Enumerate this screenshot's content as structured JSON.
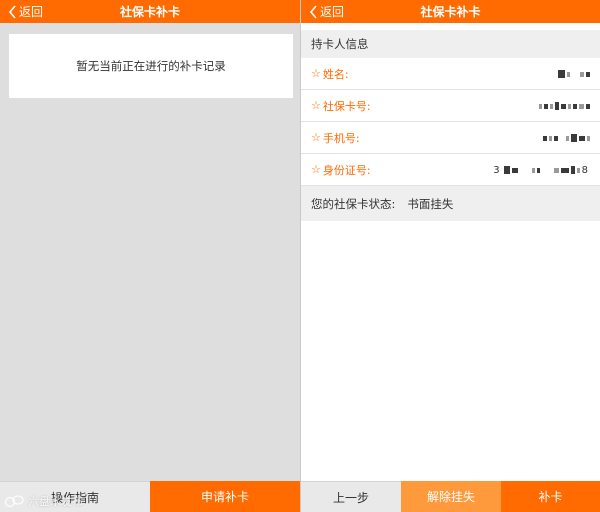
{
  "colors": {
    "brand": "#ff6b00",
    "secondary_action": "#ff9a3c",
    "background": "#dedede"
  },
  "left": {
    "nav": {
      "back_label": "返回",
      "title": "社保卡补卡"
    },
    "empty_message": "暂无当前正在进行的补卡记录",
    "bottom": {
      "guide_label": "操作指南",
      "apply_label": "申请补卡"
    },
    "watermark": "六盘水发布"
  },
  "right": {
    "nav": {
      "back_label": "返回",
      "title": "社保卡补卡"
    },
    "section_title": "持卡人信息",
    "fields": [
      {
        "star": "☆",
        "label": "姓名:",
        "value": ""
      },
      {
        "star": "☆",
        "label": "社保卡号:",
        "value": ""
      },
      {
        "star": "☆",
        "label": "手机号:",
        "value": ""
      },
      {
        "star": "☆",
        "label": "身份证号:",
        "value_prefix": "3",
        "value_suffix": "8"
      }
    ],
    "status_label": "您的社保卡状态:",
    "status_value": "书面挂失",
    "bottom": {
      "prev_label": "上一步",
      "unlock_label": "解除挂失",
      "reissue_label": "补卡"
    }
  }
}
